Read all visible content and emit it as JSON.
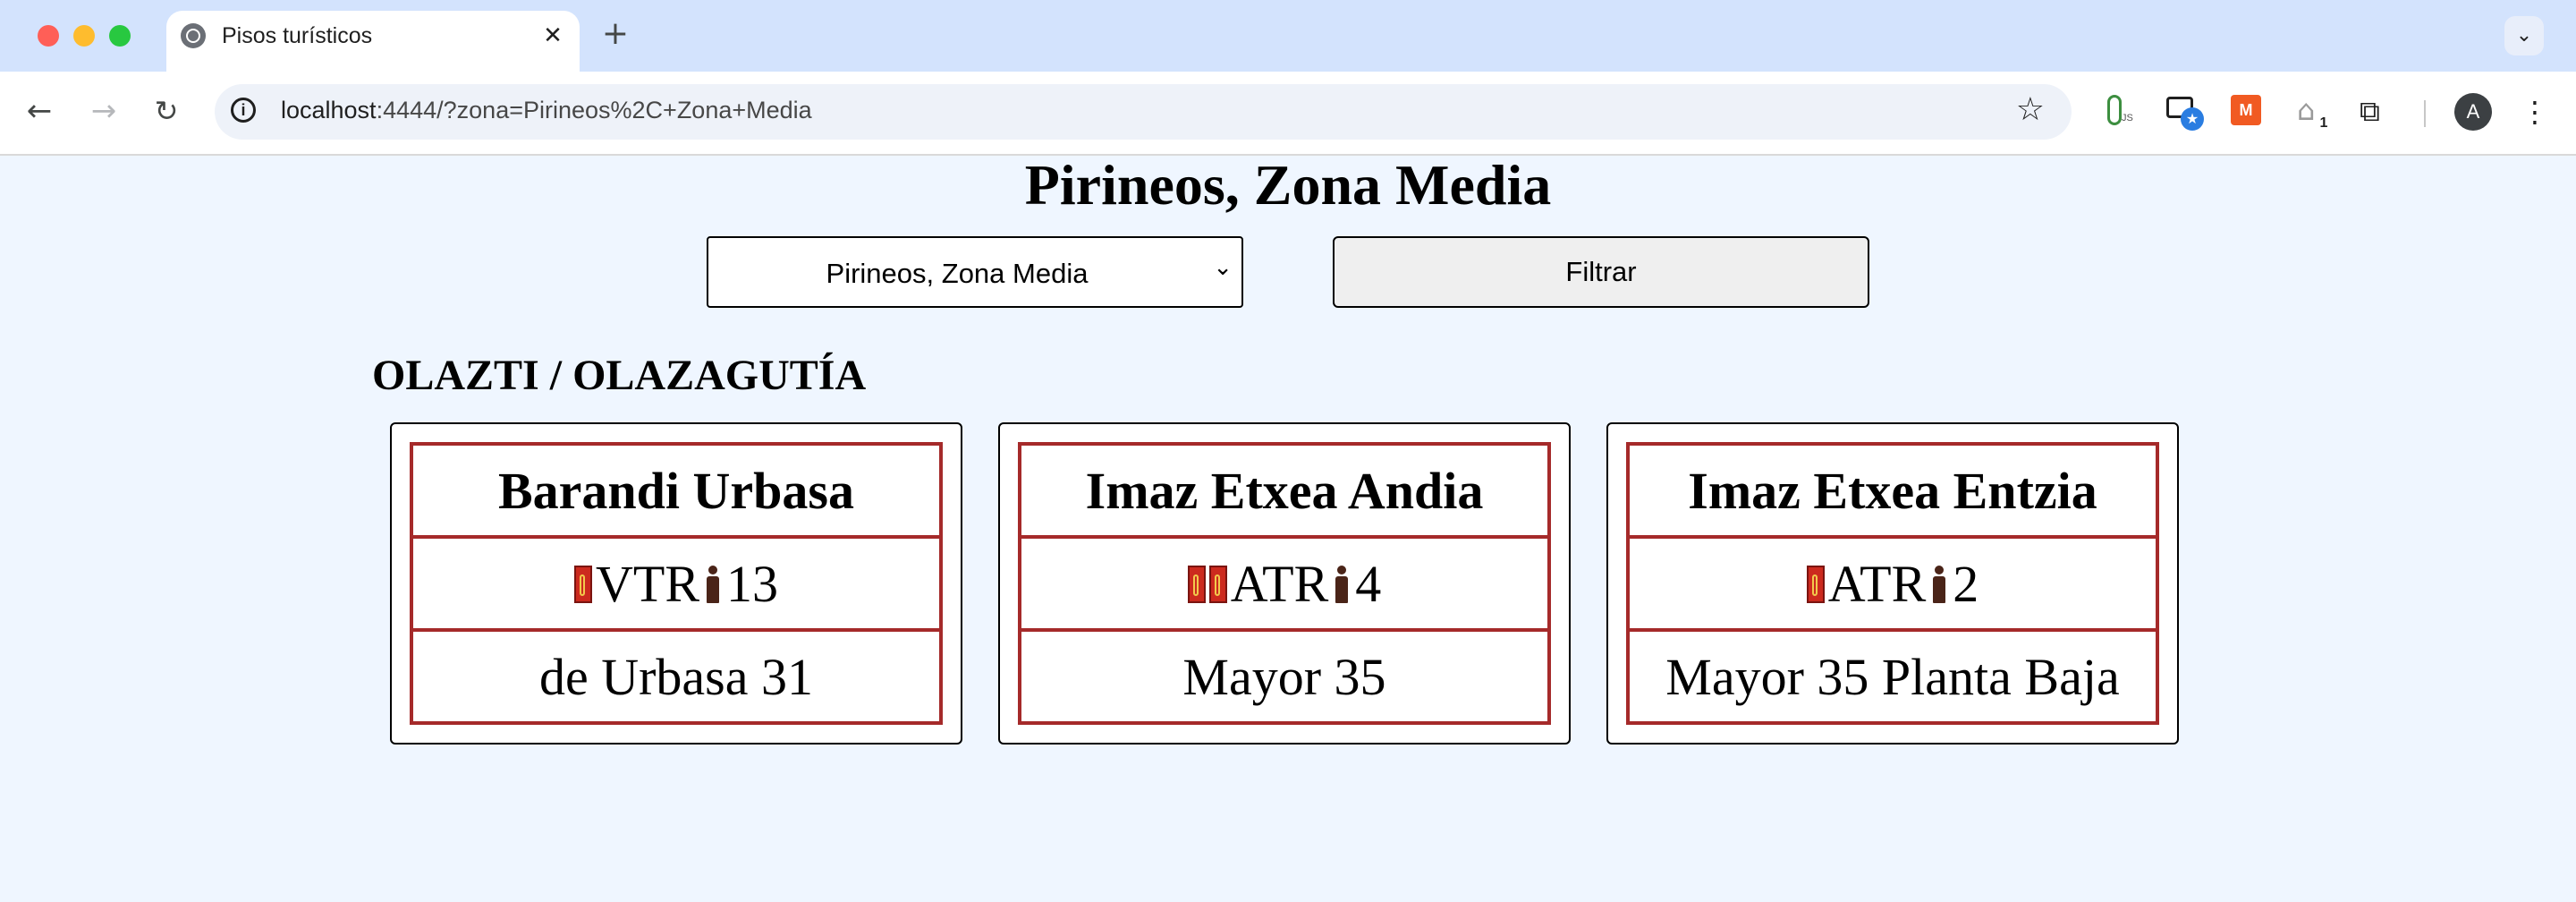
{
  "browser": {
    "tab_title": "Pisos turísticos",
    "tab_close": "✕",
    "new_tab": "+",
    "url_host": "localhost",
    "url_rest": ":4444/?zona=Pirineos%2C+Zona+Media",
    "avatar_letter": "A",
    "extension_badge_count": "1",
    "extension_js_label": "JS",
    "extension_orange_label": "M"
  },
  "page": {
    "title": "Pirineos, Zona Media",
    "zone_select": {
      "selected": "Pirineos, Zona Media"
    },
    "filter_button": "Filtrar",
    "town": "OLAZTI / OLAZAGUTÍA",
    "cards": [
      {
        "name": "Barandi Urbasa",
        "keys": 1,
        "type": "VTR",
        "capacity": "13",
        "address": "de Urbasa 31"
      },
      {
        "name": "Imaz Etxea Andia",
        "keys": 2,
        "type": "ATR",
        "capacity": "4",
        "address": "Mayor 35"
      },
      {
        "name": "Imaz Etxea Entzia",
        "keys": 1,
        "type": "ATR",
        "capacity": "2",
        "address": "Mayor 35 Planta Baja"
      }
    ]
  },
  "colors": {
    "page_background": "#eff6ff",
    "card_border": "#a52a2a",
    "key_icon": "#cc2a1e",
    "person_icon": "#4a2418"
  },
  "icons": {
    "key": "key-icon",
    "person": "person-icon"
  }
}
